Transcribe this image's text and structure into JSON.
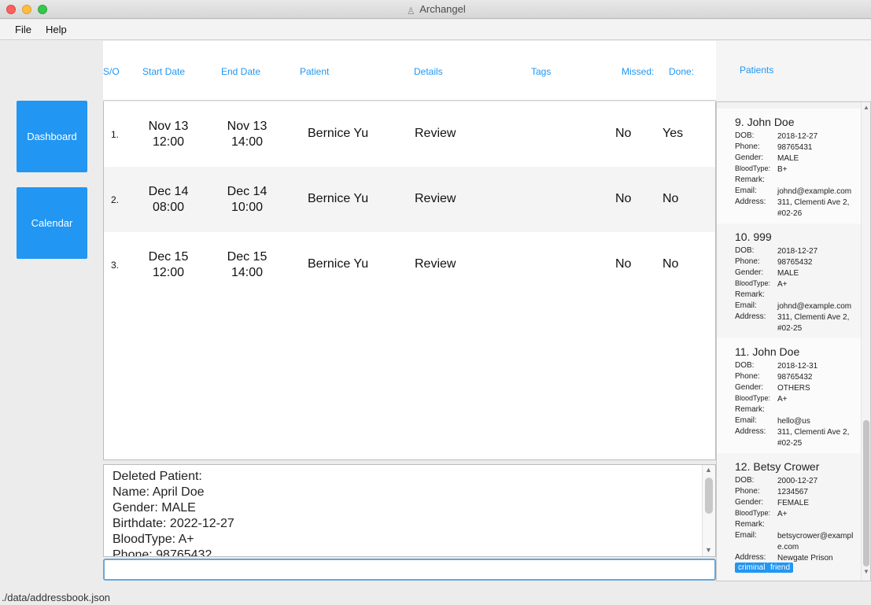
{
  "window": {
    "title": "Archangel"
  },
  "menu": {
    "file": "File",
    "help": "Help"
  },
  "sidebar": {
    "dashboard": "Dashboard",
    "calendar": "Calendar"
  },
  "table": {
    "headers": {
      "sn": "S/O",
      "start": "Start Date",
      "end": "End Date",
      "patient": "Patient",
      "details": "Details",
      "tags": "Tags",
      "missed": "Missed:",
      "done": "Done:"
    },
    "rows": [
      {
        "sn": "1.",
        "start_date": "Nov 13",
        "start_time": "12:00",
        "end_date": "Nov 13",
        "end_time": "14:00",
        "patient": "Bernice Yu",
        "details": "Review",
        "missed": "No",
        "done": "Yes"
      },
      {
        "sn": "2.",
        "start_date": "Dec 14",
        "start_time": "08:00",
        "end_date": "Dec 14",
        "end_time": "10:00",
        "patient": "Bernice Yu",
        "details": "Review",
        "missed": "No",
        "done": "No"
      },
      {
        "sn": "3.",
        "start_date": "Dec 15",
        "start_time": "12:00",
        "end_date": "Dec 15",
        "end_time": "14:00",
        "patient": "Bernice Yu",
        "details": "Review",
        "missed": "No",
        "done": "No"
      }
    ]
  },
  "result": {
    "lines": [
      "Deleted Patient:",
      "Name: April Doe",
      "Gender: MALE",
      "Birthdate: 2022-12-27",
      "BloodType: A+",
      "Phone: 98765432"
    ]
  },
  "command": {
    "value": ""
  },
  "status": {
    "path": "./data/addressbook.json"
  },
  "patients": {
    "header": "Patients",
    "labels": {
      "dob": "DOB:",
      "phone": "Phone:",
      "gender": "Gender:",
      "blood": "BloodType:",
      "remark": "Remark:",
      "email": "Email:",
      "address": "Address:"
    },
    "items": [
      {
        "name": "9. John Doe",
        "dob": "2018-12-27",
        "phone": "98765431",
        "gender": "MALE",
        "blood": "B+",
        "remark": "",
        "email": "johnd@example.com",
        "address1": "311, Clementi Ave 2,",
        "address2": "#02-26",
        "tags": []
      },
      {
        "name": "10. 999",
        "dob": "2018-12-27",
        "phone": "98765432",
        "gender": "MALE",
        "blood": "A+",
        "remark": "",
        "email": "johnd@example.com",
        "address1": "311, Clementi Ave 2,",
        "address2": "#02-25",
        "tags": []
      },
      {
        "name": "11. John Doe",
        "dob": "2018-12-31",
        "phone": "98765432",
        "gender": "OTHERS",
        "blood": "A+",
        "remark": "",
        "email": "hello@us",
        "address1": "311, Clementi Ave 2,",
        "address2": "#02-25",
        "tags": []
      },
      {
        "name": "12. Betsy Crower",
        "dob": "2000-12-27",
        "phone": "1234567",
        "gender": "FEMALE",
        "blood": "A+",
        "remark": "",
        "email": "betsycrower@exampl",
        "email2": "e.com",
        "address1": "Newgate Prison",
        "address2": "",
        "tags": [
          "criminal",
          "friend"
        ]
      }
    ]
  },
  "colors": {
    "accent": "#2196f3"
  }
}
